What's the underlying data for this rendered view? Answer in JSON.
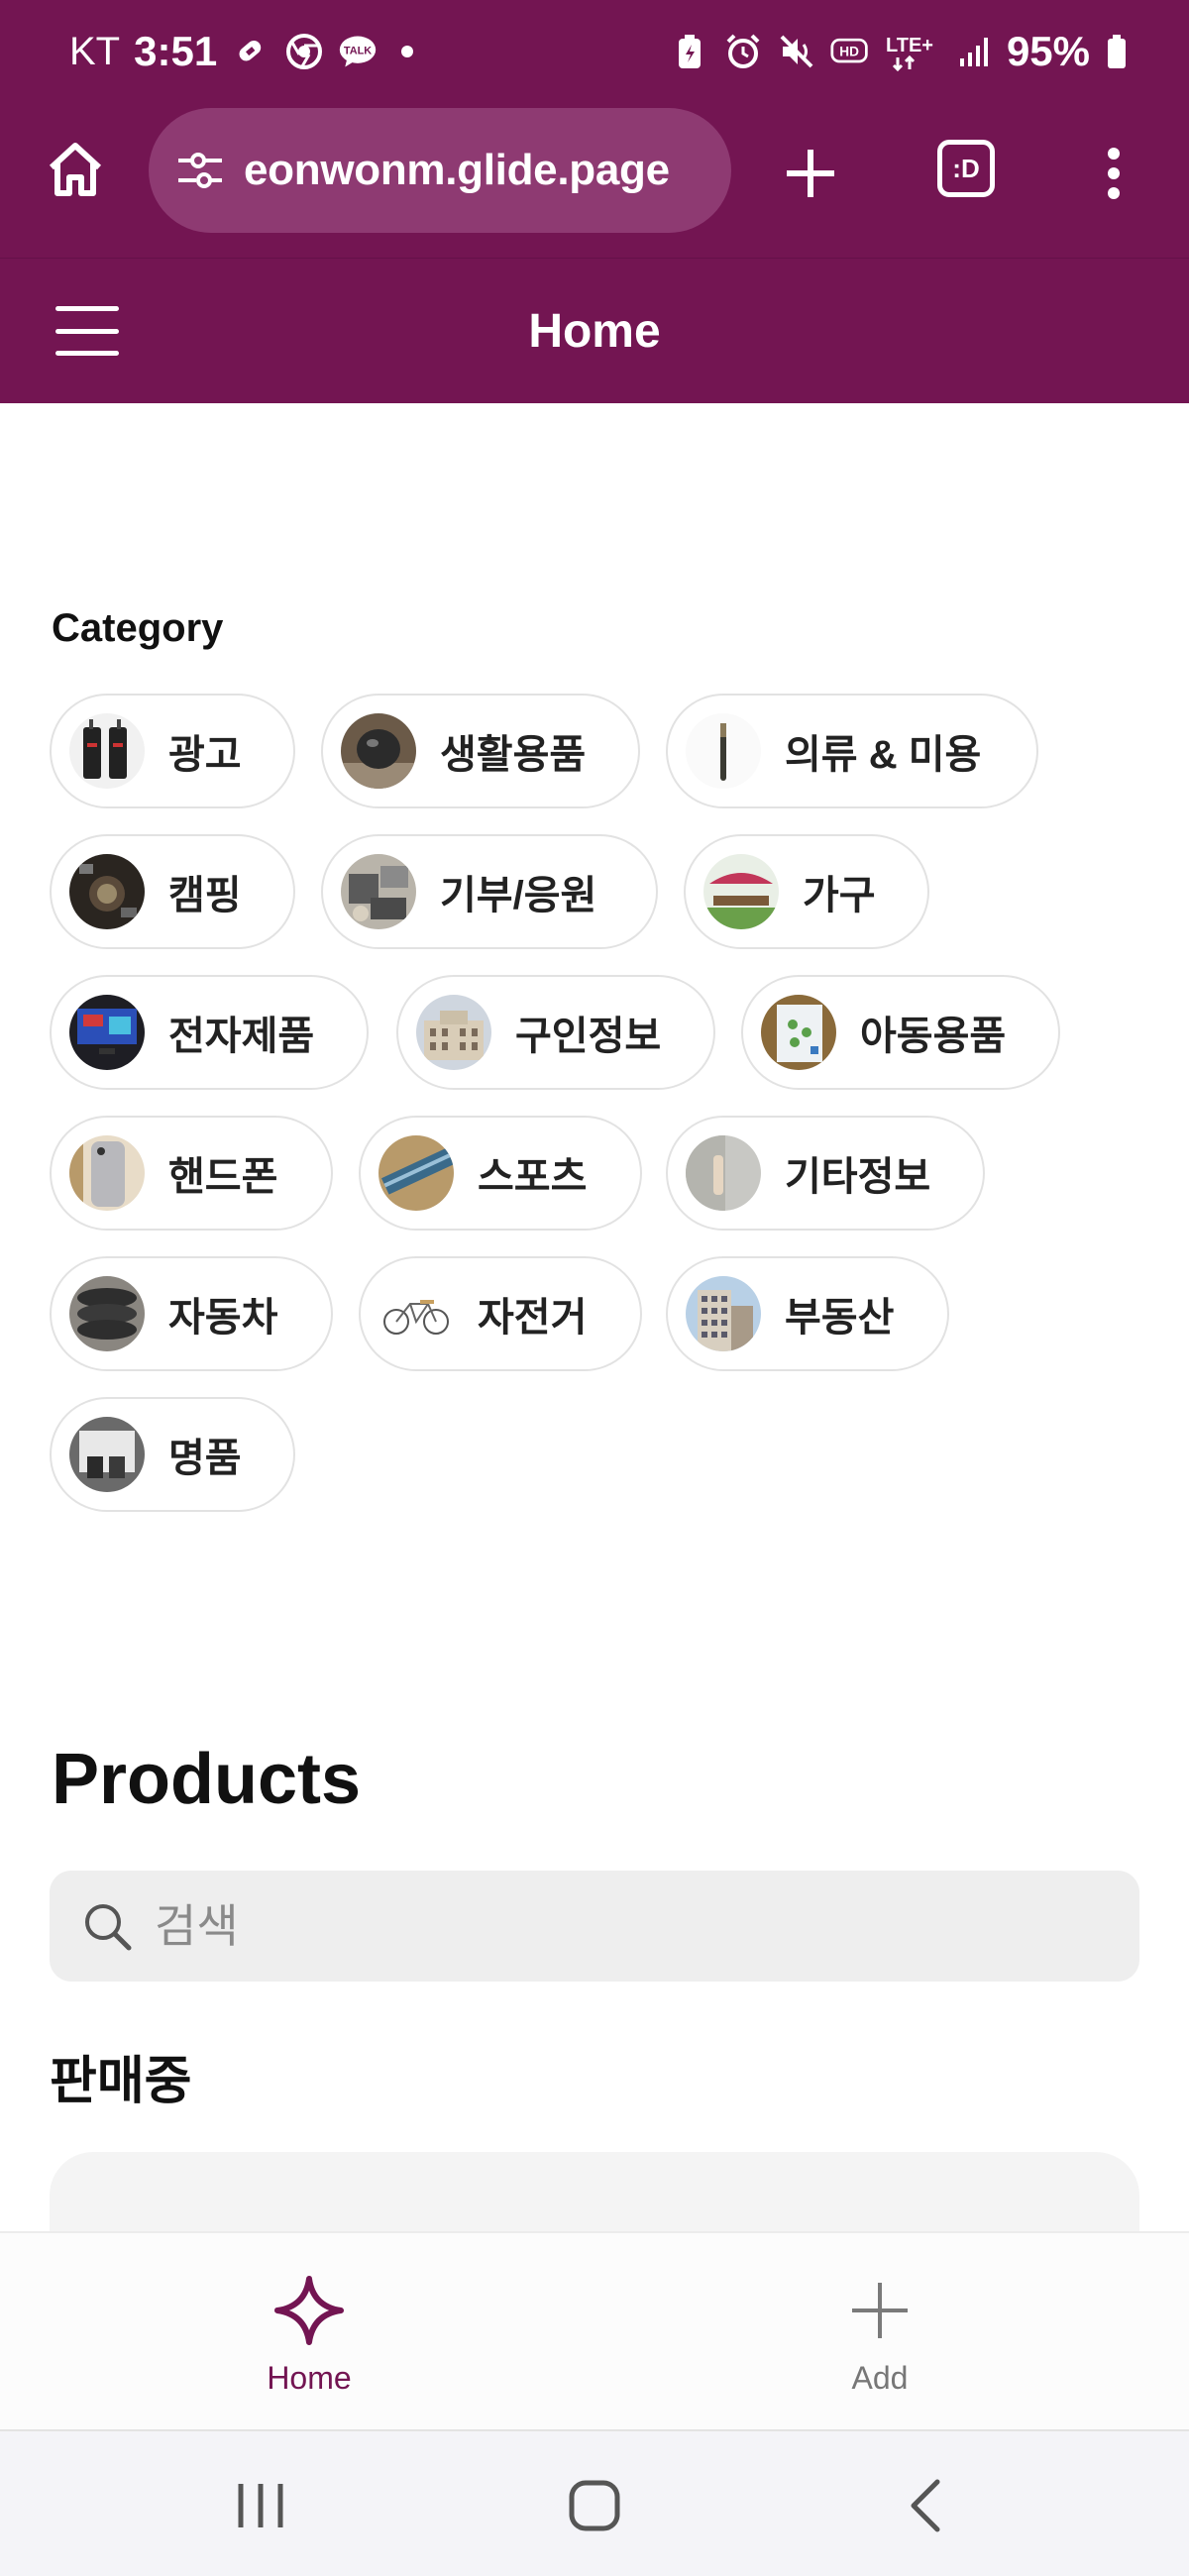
{
  "status_bar": {
    "carrier": "KT",
    "time": "3:51",
    "battery": "95%",
    "network": "LTE+",
    "left_icons": [
      "link-icon",
      "chrome-icon",
      "talk-icon"
    ],
    "right_icons": [
      "battery-saver-icon",
      "alarm-icon",
      "mute-icon",
      "hd-icon",
      "lte-icon",
      "signal-icon",
      "battery-icon"
    ],
    "talk_badge": "TALK",
    "hd_badge": "HD"
  },
  "browser": {
    "url": "eonwonm.glide.page",
    "tab_switcher_label": ":D"
  },
  "app_header": {
    "title": "Home"
  },
  "category": {
    "label": "Category",
    "items": [
      {
        "label": "광고",
        "icon": "ad-thumb"
      },
      {
        "label": "생활용품",
        "icon": "household-thumb"
      },
      {
        "label": "의류 & 미용",
        "icon": "clothing-beauty-thumb"
      },
      {
        "label": "캠핑",
        "icon": "camping-thumb"
      },
      {
        "label": "기부/응원",
        "icon": "donation-thumb"
      },
      {
        "label": "가구",
        "icon": "furniture-thumb"
      },
      {
        "label": "전자제품",
        "icon": "electronics-thumb"
      },
      {
        "label": "구인정보",
        "icon": "jobs-thumb"
      },
      {
        "label": "아동용품",
        "icon": "kids-thumb"
      },
      {
        "label": "핸드폰",
        "icon": "phone-thumb"
      },
      {
        "label": "스포츠",
        "icon": "sports-thumb"
      },
      {
        "label": "기타정보",
        "icon": "other-info-thumb"
      },
      {
        "label": "자동차",
        "icon": "car-thumb"
      },
      {
        "label": "자전거",
        "icon": "bicycle-thumb"
      },
      {
        "label": "부동산",
        "icon": "real-estate-thumb"
      },
      {
        "label": "명품",
        "icon": "luxury-thumb"
      }
    ]
  },
  "products": {
    "title": "Products",
    "search_placeholder": "검색",
    "section_title": "판매중"
  },
  "tab_bar": {
    "home_label": "Home",
    "add_label": "Add",
    "active_color": "#731552",
    "inactive_color": "#777777"
  },
  "colors": {
    "brand": "#731552",
    "url_pill": "#8e3a72"
  }
}
